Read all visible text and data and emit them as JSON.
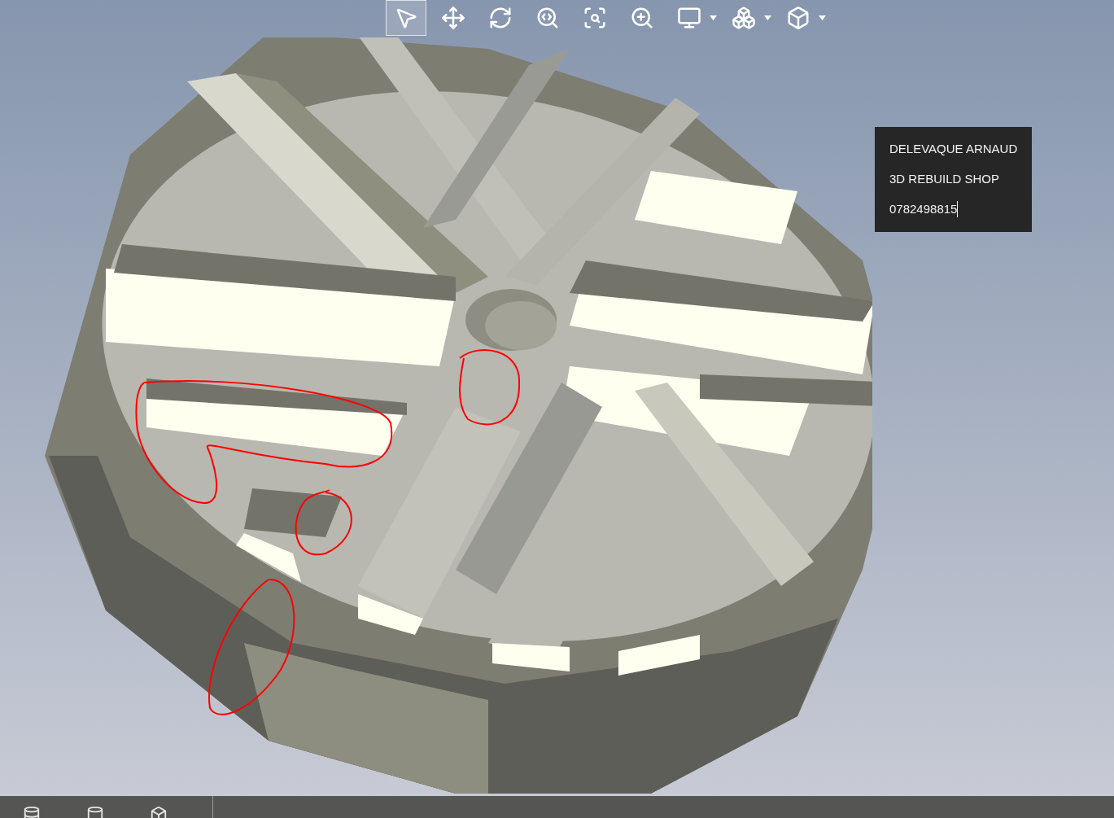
{
  "toolbar": {
    "tools": [
      {
        "selected": true,
        "has_dropdown": false
      },
      {
        "selected": false,
        "has_dropdown": false
      },
      {
        "selected": false,
        "has_dropdown": false
      },
      {
        "selected": false,
        "has_dropdown": false
      },
      {
        "selected": false,
        "has_dropdown": false
      },
      {
        "selected": false,
        "has_dropdown": false
      },
      {
        "selected": false,
        "has_dropdown": true
      },
      {
        "selected": false,
        "has_dropdown": true
      },
      {
        "selected": false,
        "has_dropdown": true
      }
    ]
  },
  "note": {
    "lines": [
      "DELEVAQUE ARNAUD",
      "3D REBUILD SHOP",
      "0782498815"
    ],
    "cursor_visible": true
  }
}
